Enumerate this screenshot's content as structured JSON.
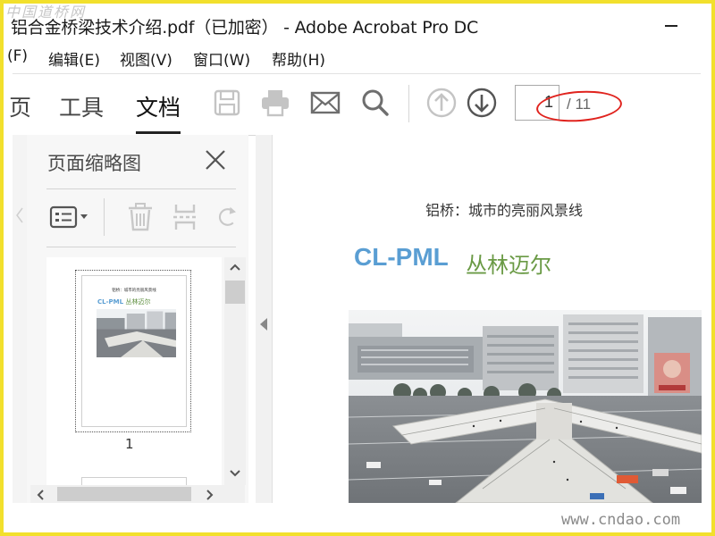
{
  "window": {
    "title": "铝合金桥梁技术介绍.pdf（已加密） - Adobe Acrobat Pro DC"
  },
  "menu": [
    "(F)",
    "编辑(E)",
    "视图(V)",
    "窗口(W)",
    "帮助(H)"
  ],
  "toolbar": {
    "tabs": [
      "页",
      "工具",
      "文档"
    ],
    "active_tab": "文档",
    "icons": [
      "save-icon",
      "print-icon",
      "email-icon",
      "search-icon",
      "previous-page-icon",
      "next-page-icon"
    ],
    "current_page": "1",
    "total_pages": "/ 11"
  },
  "panel": {
    "title": "页面缩略图",
    "tools": [
      "thumbnail-options-icon",
      "delete-page-icon",
      "extract-page-icon",
      "rotate-page-icon"
    ],
    "thumbnail_label": "1"
  },
  "document": {
    "heading": "铝桥：城市的亮丽风景线",
    "brand": "CL-PML",
    "brand_cn": "丛林迈尔"
  },
  "thumbnail": {
    "heading": "铝桥：城市的亮丽风景线",
    "brand": "CL-PML",
    "brand_cn": "丛林迈尔"
  },
  "watermarks": {
    "top": "中国道桥网",
    "bottom": "www.cndao.com"
  },
  "colors": {
    "brand_blue": "#5a9ed3",
    "brand_green": "#6a9a45",
    "highlight_red": "#e0231e",
    "frame_yellow": "#f2e02c"
  }
}
